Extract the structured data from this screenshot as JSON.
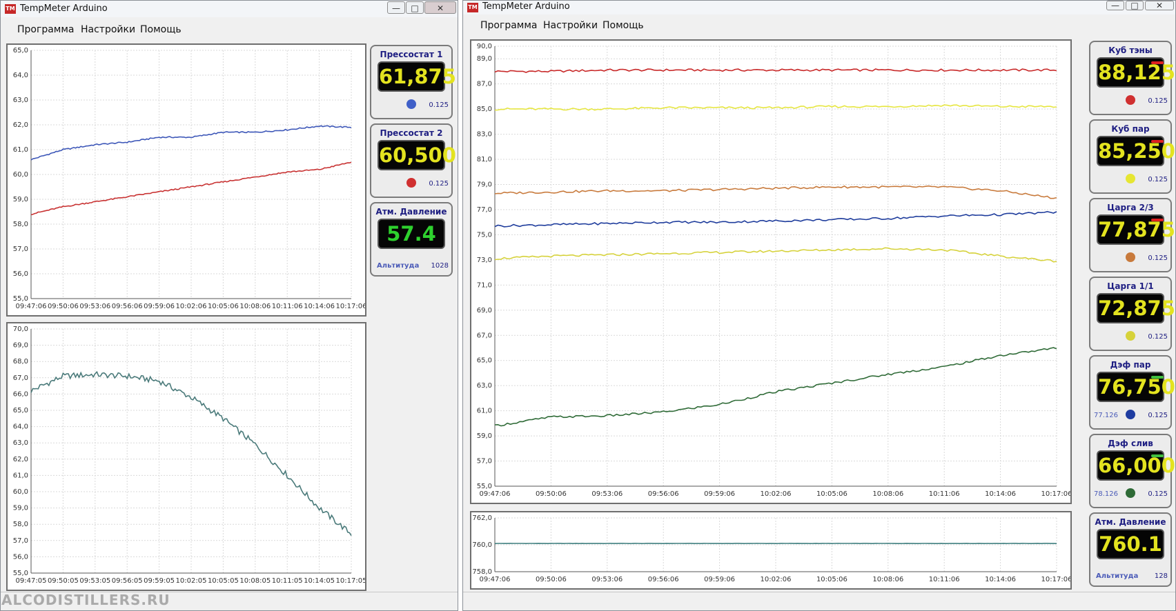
{
  "watermark": "ALCODISTILLERS.RU",
  "left_window": {
    "title": "TempMeter Arduino",
    "menu": [
      "Программа",
      "Настройки",
      "Помощь"
    ],
    "gauges": [
      {
        "title": "Прессостат 1",
        "value": "61,875",
        "step": "0.125",
        "dot": "#4060c8"
      },
      {
        "title": "Прессостат 2",
        "value": "60,500",
        "step": "0.125",
        "dot": "#d03030"
      },
      {
        "title": "Атм. Давление",
        "value": "57.4",
        "extra_label": "Альтитуда",
        "extra_value": "1028"
      }
    ]
  },
  "right_window": {
    "title": "TempMeter Arduino",
    "menu": [
      "Программа",
      "Настройки",
      "Помощь"
    ],
    "gauges": [
      {
        "title": "Куб тэны",
        "value": "88,125",
        "step": "0.125",
        "dot": "#d03030",
        "flag": "#e02020"
      },
      {
        "title": "Куб пар",
        "value": "85,250",
        "step": "0.125",
        "dot": "#e6e632",
        "flag": "#e02020"
      },
      {
        "title": "Царга 2/3",
        "value": "77,875",
        "step": "0.125",
        "dot": "#c87a3c",
        "flag": "#e02020"
      },
      {
        "title": "Царга 1/1",
        "value": "72,875",
        "step": "0.125",
        "dot": "#d6d23a"
      },
      {
        "title": "Дэф пар",
        "value": "76,750",
        "step": "0.125",
        "dot": "#1e3ca0",
        "extra": "77.126",
        "flag": "#40c040"
      },
      {
        "title": "Дэф слив",
        "value": "66,000",
        "step": "0.125",
        "dot": "#2e6a36",
        "extra": "78.126",
        "flag": "#40c040"
      },
      {
        "title": "Атм. Давление",
        "value": "760.1",
        "extra_label": "Альтитуда",
        "extra_value": "128"
      }
    ]
  },
  "chart_data": [
    {
      "id": "chart-pressure-top",
      "type": "line",
      "x": [
        "09:47:06",
        "09:50:06",
        "09:53:06",
        "09:56:06",
        "09:59:06",
        "10:02:06",
        "10:05:06",
        "10:08:06",
        "10:11:06",
        "10:14:06",
        "10:17:06"
      ],
      "ylim": [
        55,
        65
      ],
      "yticks": [
        "55,0",
        "56,0",
        "57,0",
        "58,0",
        "59,0",
        "60,0",
        "61,0",
        "62,0",
        "63,0",
        "64,0",
        "65,0"
      ],
      "grid": true,
      "series": [
        {
          "color": "#3d57b8",
          "values": [
            60.6,
            61.0,
            61.2,
            61.3,
            61.5,
            61.5,
            61.7,
            61.7,
            61.8,
            61.95,
            61.9
          ]
        },
        {
          "color": "#c83232",
          "values": [
            58.4,
            58.7,
            58.9,
            59.1,
            59.3,
            59.5,
            59.7,
            59.9,
            60.1,
            60.2,
            60.5
          ]
        }
      ]
    },
    {
      "id": "chart-pressure-bottom",
      "type": "line",
      "x": [
        "09:47:05",
        "09:50:05",
        "09:53:05",
        "09:56:05",
        "09:59:05",
        "10:02:05",
        "10:05:05",
        "10:08:05",
        "10:11:05",
        "10:14:05",
        "10:17:05"
      ],
      "ylim": [
        55,
        70
      ],
      "yticks": [
        "55,0",
        "56,0",
        "57,0",
        "58,0",
        "59,0",
        "60,0",
        "61,0",
        "62,0",
        "63,0",
        "64,0",
        "65,0",
        "66,0",
        "67,0",
        "68,0",
        "69,0",
        "70,0"
      ],
      "grid": true,
      "series": [
        {
          "color": "#4a7a7a",
          "values": [
            66.2,
            67.1,
            67.2,
            67.1,
            66.8,
            65.8,
            64.5,
            62.9,
            61.0,
            59.0,
            57.4
          ]
        }
      ]
    },
    {
      "id": "chart-temperatures",
      "type": "line",
      "x": [
        "09:47:06",
        "09:50:06",
        "09:53:06",
        "09:56:06",
        "09:59:06",
        "10:02:06",
        "10:05:06",
        "10:08:06",
        "10:11:06",
        "10:14:06",
        "10:17:06"
      ],
      "ylim": [
        55,
        90
      ],
      "yticks": [
        "55,0",
        "57,0",
        "59,0",
        "61,0",
        "63,0",
        "65,0",
        "67,0",
        "69,0",
        "71,0",
        "73,0",
        "75,0",
        "77,0",
        "79,0",
        "81,0",
        "83,0",
        "85,0",
        "87,0",
        "89,0",
        "90,0"
      ],
      "grid": true,
      "series": [
        {
          "color": "#c82828",
          "values": [
            88.0,
            88.0,
            88.1,
            88.1,
            88.1,
            88.1,
            88.1,
            88.1,
            88.1,
            88.1,
            88.1
          ]
        },
        {
          "color": "#e6e640",
          "values": [
            85.0,
            85.0,
            85.0,
            85.1,
            85.1,
            85.1,
            85.2,
            85.2,
            85.3,
            85.2,
            85.2
          ]
        },
        {
          "color": "#c87a3c",
          "values": [
            78.3,
            78.4,
            78.5,
            78.5,
            78.6,
            78.7,
            78.8,
            78.8,
            78.8,
            78.5,
            77.9
          ]
        },
        {
          "color": "#1e3c9c",
          "values": [
            75.7,
            75.8,
            75.9,
            76.0,
            76.0,
            76.1,
            76.2,
            76.3,
            76.5,
            76.6,
            76.8
          ]
        },
        {
          "color": "#d6d23c",
          "values": [
            73.1,
            73.3,
            73.4,
            73.5,
            73.6,
            73.7,
            73.8,
            73.9,
            73.8,
            73.3,
            72.9
          ]
        },
        {
          "color": "#2e6a36",
          "values": [
            59.8,
            60.5,
            60.6,
            60.9,
            61.5,
            62.5,
            63.2,
            63.9,
            64.5,
            65.4,
            66.0
          ]
        }
      ]
    },
    {
      "id": "chart-atm",
      "type": "line",
      "x": [
        "09:47:06",
        "09:50:06",
        "09:53:06",
        "09:56:06",
        "09:59:06",
        "10:02:06",
        "10:05:06",
        "10:08:06",
        "10:11:06",
        "10:14:06",
        "10:17:06"
      ],
      "ylim": [
        758,
        762
      ],
      "yticks": [
        "758,0",
        "760,0",
        "762,0"
      ],
      "grid": true,
      "series": [
        {
          "color": "#3f7f7f",
          "values": [
            760.1,
            760.1,
            760.1,
            760.1,
            760.1,
            760.1,
            760.1,
            760.1,
            760.1,
            760.1,
            760.1
          ]
        }
      ]
    }
  ]
}
